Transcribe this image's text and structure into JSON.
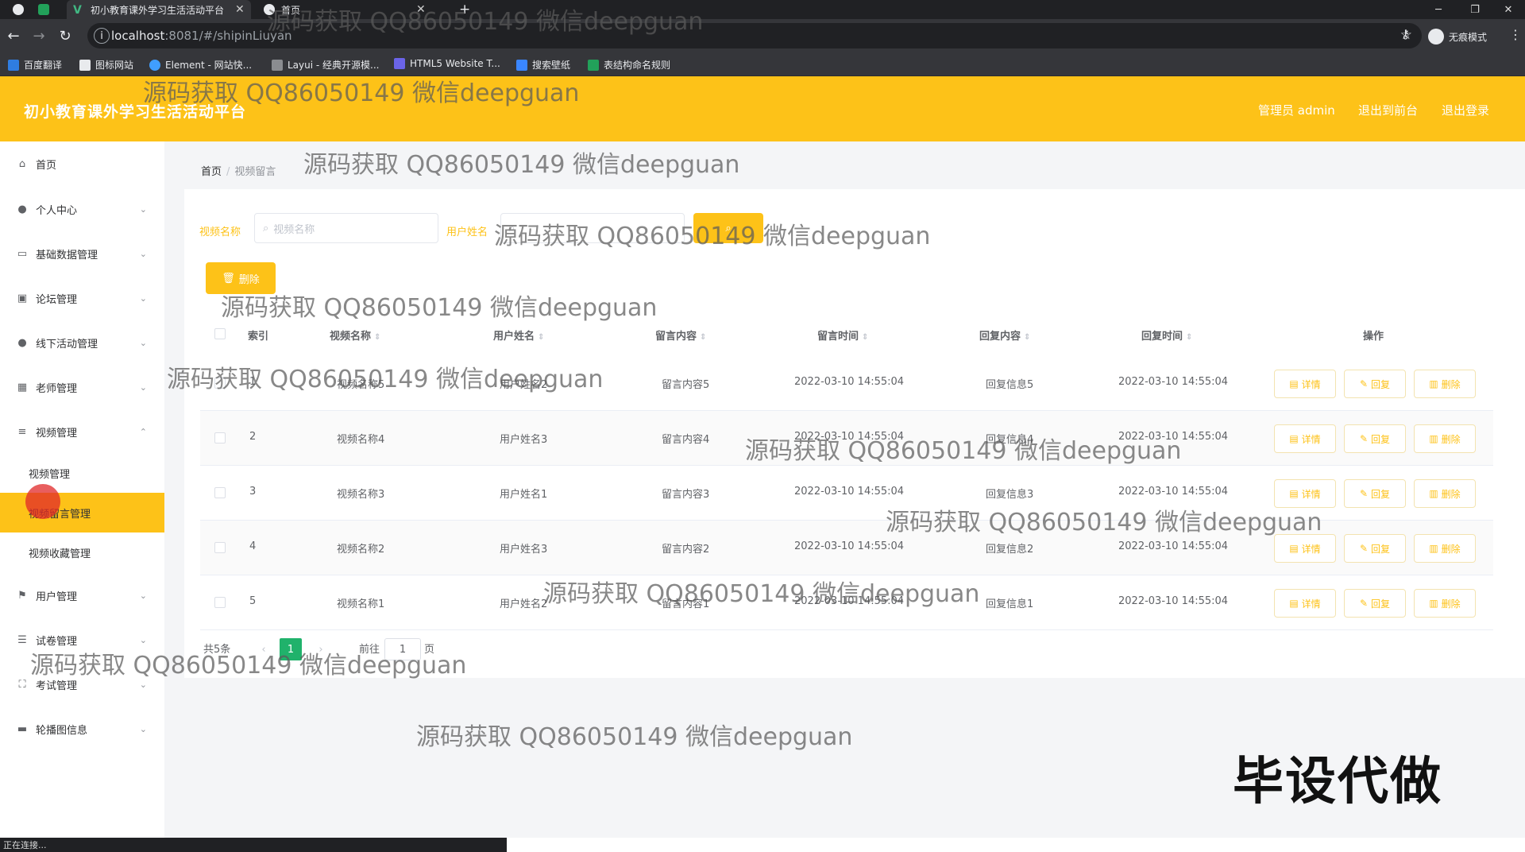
{
  "browser": {
    "tabs": [
      {
        "title": "初小教育课外学习生活活动平台"
      },
      {
        "title": "首页"
      }
    ],
    "url_host": "localhost",
    "url_rest": ":8081/#/shipinLiuyan",
    "incognito_label": "无痕模式",
    "bookmarks": [
      "百度翻译",
      "图标网站",
      "Element - 网站快...",
      "Layui - 经典开源模...",
      "HTML5 Website T...",
      "搜索壁纸",
      "表结构命名规则"
    ]
  },
  "header": {
    "title": "初小教育课外学习生活活动平台",
    "admin_label": "管理员 admin",
    "front_label": "退出到前台",
    "logout_label": "退出登录"
  },
  "sidebar": {
    "items": [
      {
        "label": "首页",
        "icon": "home-icon"
      },
      {
        "label": "个人中心",
        "icon": "user-icon"
      },
      {
        "label": "基础数据管理",
        "icon": "card-icon"
      },
      {
        "label": "论坛管理",
        "icon": "chart-icon"
      },
      {
        "label": "线下活动管理",
        "icon": "person-icon"
      },
      {
        "label": "老师管理",
        "icon": "grid-icon"
      },
      {
        "label": "视频管理",
        "icon": "menu-icon"
      },
      {
        "label": "用户管理",
        "icon": "flag-icon"
      },
      {
        "label": "试卷管理",
        "icon": "sliders-icon"
      },
      {
        "label": "考试管理",
        "icon": "crop-icon"
      },
      {
        "label": "轮播图信息",
        "icon": "message-icon"
      }
    ],
    "video_sub": [
      {
        "label": "视频管理"
      },
      {
        "label": "视频留言管理"
      },
      {
        "label": "视频收藏管理"
      }
    ]
  },
  "breadcrumb": {
    "home": "首页",
    "current": "视频留言"
  },
  "search": {
    "video_label": "视频名称",
    "video_placeholder": "视频名称",
    "user_label": "用户姓名",
    "delete_label": "删除"
  },
  "table": {
    "headers": [
      "索引",
      "视频名称",
      "用户姓名",
      "留言内容",
      "留言时间",
      "回复内容",
      "回复时间",
      "操作"
    ],
    "rows": [
      {
        "index": "1",
        "video": "视频名称5",
        "user": "用户姓名2",
        "content": "留言内容5",
        "time": "2022-03-10 14:55:04",
        "reply": "回复信息5",
        "reply_time": "2022-03-10 14:55:04"
      },
      {
        "index": "2",
        "video": "视频名称4",
        "user": "用户姓名3",
        "content": "留言内容4",
        "time": "2022-03-10 14:55:04",
        "reply": "回复信息4",
        "reply_time": "2022-03-10 14:55:04"
      },
      {
        "index": "3",
        "video": "视频名称3",
        "user": "用户姓名1",
        "content": "留言内容3",
        "time": "2022-03-10 14:55:04",
        "reply": "回复信息3",
        "reply_time": "2022-03-10 14:55:04"
      },
      {
        "index": "4",
        "video": "视频名称2",
        "user": "用户姓名3",
        "content": "留言内容2",
        "time": "2022-03-10 14:55:04",
        "reply": "回复信息2",
        "reply_time": "2022-03-10 14:55:04"
      },
      {
        "index": "5",
        "video": "视频名称1",
        "user": "用户姓名2",
        "content": "留言内容1",
        "time": "2022-03-10 14:55:04",
        "reply": "回复信息1",
        "reply_time": "2022-03-10 14:55:04"
      }
    ],
    "actions": {
      "detail": "详情",
      "reply": "回复",
      "delete": "删除"
    }
  },
  "pagination": {
    "total": "共5条",
    "current_page": "1",
    "goto_label": "前往",
    "goto_value": "1",
    "page_suffix": "页"
  },
  "watermark": "源码获取 QQ86050149 微信deepguan",
  "stamp": "毕设代做",
  "status": "正在连接...",
  "colors": {
    "accent": "#fdc218",
    "page_bg": "#f4f5f7",
    "chrome": "#35363a"
  }
}
